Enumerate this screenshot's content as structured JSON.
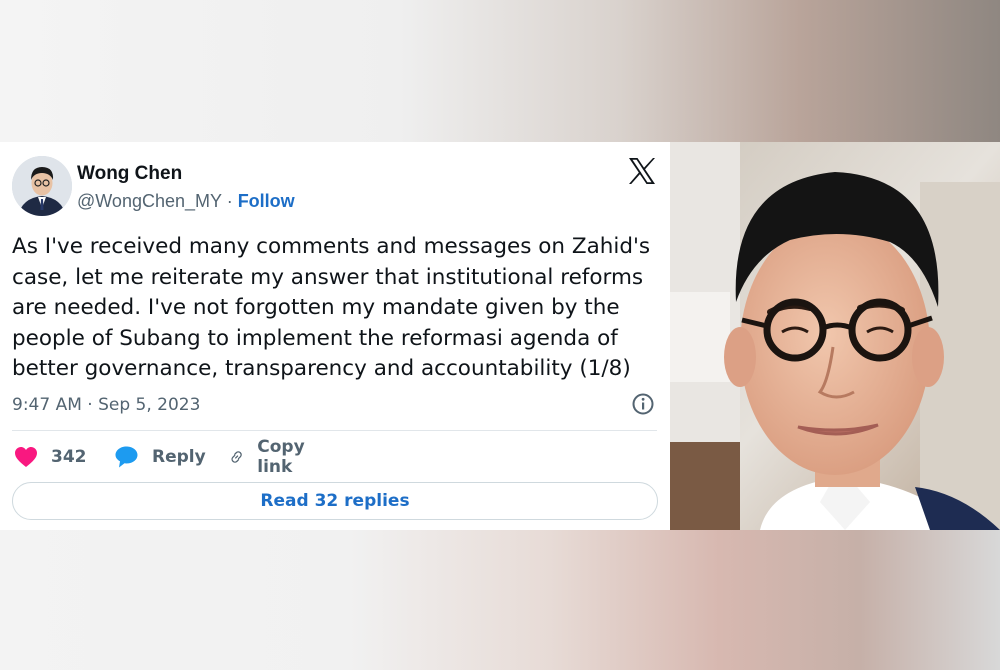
{
  "tweet": {
    "author_name": "Wong Chen",
    "handle": "@WongChen_MY",
    "separator": " · ",
    "follow_label": "Follow",
    "lines": [
      "As I've received many comments and messages on Zahid's",
      "case, let me reiterate my answer that institutional reforms",
      "are needed. I've not forgotten my mandate given by the",
      "people of Subang to implement the reformasi agenda of",
      "better governance, transparency and accountability (1/8)"
    ],
    "timestamp": "9:47 AM · Sep 5, 2023",
    "likes_count": "342",
    "reply_label": "Reply",
    "copy_link_label": "Copy link",
    "read_replies_label": "Read 32 replies"
  },
  "icons": {
    "logo": "x-logo-icon",
    "info": "info-icon",
    "like": "heart-icon",
    "reply": "speech-bubble-icon",
    "copy": "link-icon"
  },
  "colors": {
    "heart": "#f91880",
    "reply_bubble": "#1d9bf0",
    "follow_link": "#1d6ec7",
    "text": "#0f1419",
    "muted": "#536471"
  }
}
